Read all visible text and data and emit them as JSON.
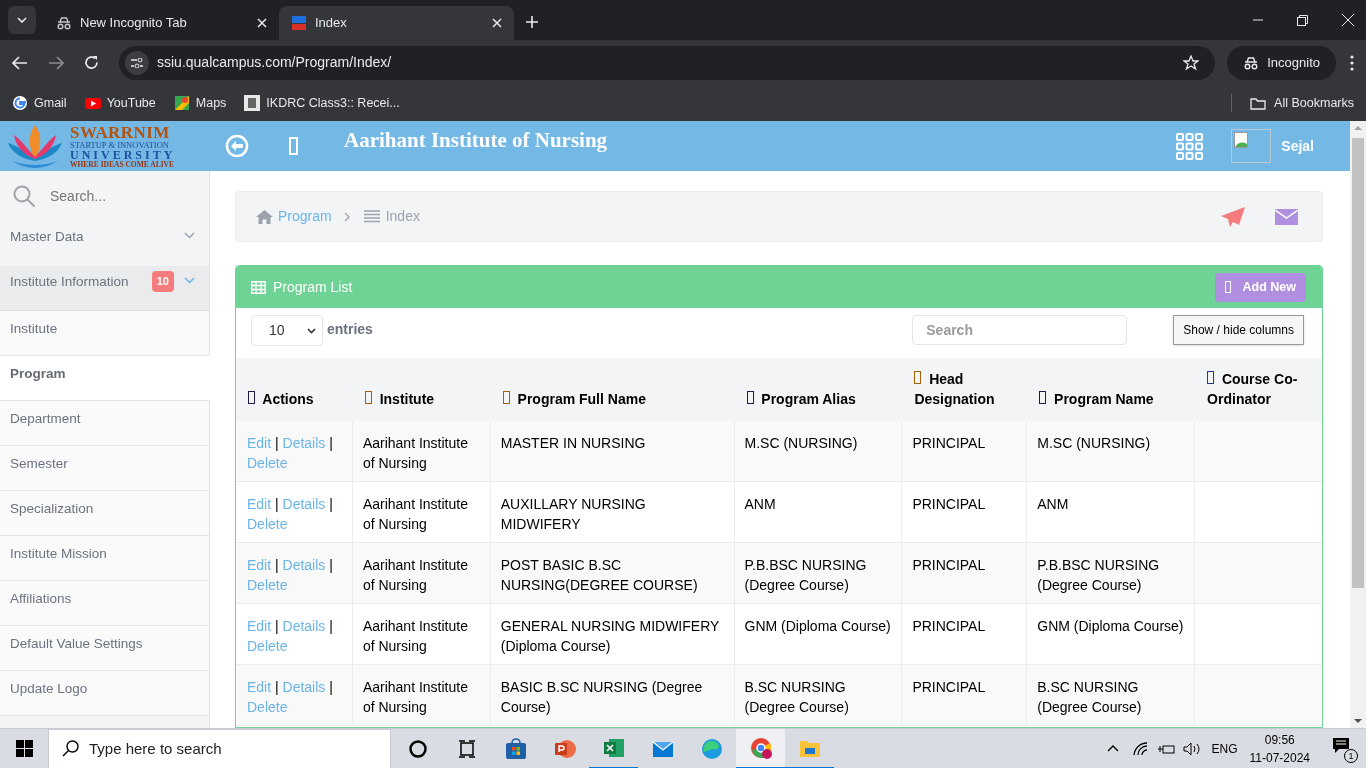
{
  "browser": {
    "tabs": [
      {
        "title": "New Incognito Tab",
        "selected": false
      },
      {
        "title": "Index",
        "selected": true
      }
    ],
    "url": "ssiu.qualcampus.com/Program/Index/",
    "profile": "Incognito",
    "bookmarks": [
      "Gmail",
      "YouTube",
      "Maps",
      "IKDRC Class3:: Recei..."
    ],
    "all_bookmarks": "All Bookmarks"
  },
  "header": {
    "logo": {
      "line_1": "SWARRNIM",
      "line_2": "STARTUP & INNOVATION",
      "line_3": "UNIVERSITY",
      "line_4": "WHERE IDEAS COME ALIVE"
    },
    "title": "Aarihant Institute of Nursing",
    "user": "Sejal"
  },
  "sidebar": {
    "search_placeholder": "Search...",
    "items": [
      {
        "label": "Master Data",
        "kind": "group",
        "expanded": false
      },
      {
        "label": "Institute Information",
        "kind": "group",
        "expanded": true,
        "badge": "10"
      },
      {
        "label": "Institute",
        "kind": "link",
        "selected": false
      },
      {
        "label": "Program",
        "kind": "link",
        "selected": true
      },
      {
        "label": "Department",
        "kind": "link",
        "selected": false
      },
      {
        "label": "Semester",
        "kind": "link",
        "selected": false
      },
      {
        "label": "Specialization",
        "kind": "link",
        "selected": false
      },
      {
        "label": "Institute Mission",
        "kind": "link",
        "selected": false
      },
      {
        "label": "Affiliations",
        "kind": "link",
        "selected": false
      },
      {
        "label": "Default Value Settings",
        "kind": "link",
        "selected": false
      },
      {
        "label": "Update Logo",
        "kind": "link",
        "selected": false
      }
    ]
  },
  "breadcrumb": [
    "Program",
    "Index"
  ],
  "panel": {
    "title": "Program List",
    "add_button": "Add New",
    "page_size": "10",
    "entries_label": "entries",
    "search_placeholder": "Search",
    "columns_button": "Show / hide columns",
    "columns": [
      "Actions",
      "Institute",
      "Program Full Name",
      "Program Alias",
      "Head Designation",
      "Program Name",
      "Course Co-Ordinator"
    ],
    "rows": [
      [
        [
          "Edit",
          "|",
          "Details",
          "|",
          "Delete"
        ],
        "Aarihant Institute of Nursing",
        "MASTER IN NURSING",
        "M.SC (NURSING)",
        "PRINCIPAL",
        "M.SC (NURSING)"
      ],
      [
        [
          "Edit",
          "|",
          "Details",
          "|",
          "Delete"
        ],
        "Aarihant Institute of Nursing",
        "AUXILLARY NURSING MIDWIFERY",
        "ANM",
        "PRINCIPAL",
        "ANM"
      ],
      [
        [
          "Edit",
          "|",
          "Details",
          "|",
          "Delete"
        ],
        "Aarihant Institute of Nursing",
        "POST BASIC B.SC NURSING(DEGREE COURSE)",
        "P.B.BSC NURSING (Degree Course)",
        "PRINCIPAL",
        "P.B.BSC NURSING (Degree Course)"
      ],
      [
        [
          "Edit",
          "|",
          "Details",
          "|",
          "Delete"
        ],
        "Aarihant Institute of Nursing",
        "GENERAL NURSING MIDWIFERY (Diploma Course)",
        "GNM (Diploma Course)",
        "PRINCIPAL",
        "GNM (Diploma Course)"
      ],
      [
        [
          "Edit",
          "|",
          "Details",
          "|",
          "Delete"
        ],
        "Aarihant Institute of Nursing",
        "BASIC B.SC NURSING (Degree Course)",
        "B.SC NURSING (Degree Course)",
        "PRINCIPAL",
        "B.SC NURSING (Degree Course)"
      ]
    ]
  },
  "taskbar": {
    "search_placeholder": "Type here to search",
    "language": "ENG",
    "time": "09:56",
    "date": "11-07-2024",
    "notifications": "1"
  }
}
